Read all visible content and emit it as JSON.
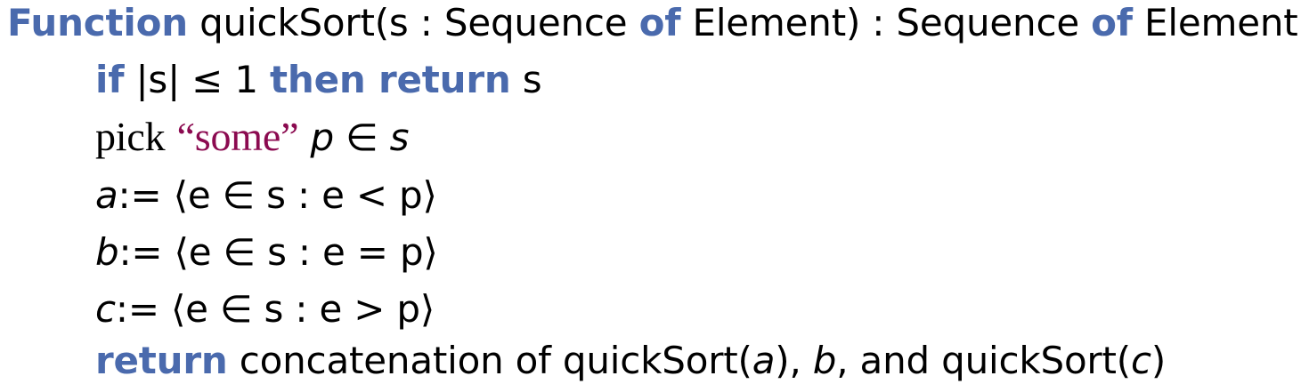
{
  "header": {
    "keyword": "Function",
    "signature": "quickSort(s : Sequence",
    "of1": "of",
    "middle": "Element) : Sequence",
    "of2": "of",
    "tail": "Element"
  },
  "line_if": {
    "kw_if": "if",
    "cond": "|s| ≤ 1",
    "kw_then_return": "then return",
    "ret": "s"
  },
  "line_pick": {
    "pick": "pick",
    "some": "“some”",
    "expr": "p ∈ s"
  },
  "line_a": {
    "var": "a",
    "expr": ":= ⟨e ∈ s : e < p⟩"
  },
  "line_b": {
    "var": "b",
    "expr": ":= ⟨e ∈ s : e = p⟩"
  },
  "line_c": {
    "var": "c",
    "expr": ":= ⟨e ∈ s : e > p⟩"
  },
  "line_return": {
    "kw": "return",
    "text1": "concatenation of quickSort(",
    "a": "a",
    "text2": "),",
    "b": "b",
    "text3": ", and quickSort(",
    "c": "c",
    "text4": ")"
  },
  "colors": {
    "keyword": "#4a6aad",
    "string": "#8b0a50",
    "text": "#000000"
  }
}
